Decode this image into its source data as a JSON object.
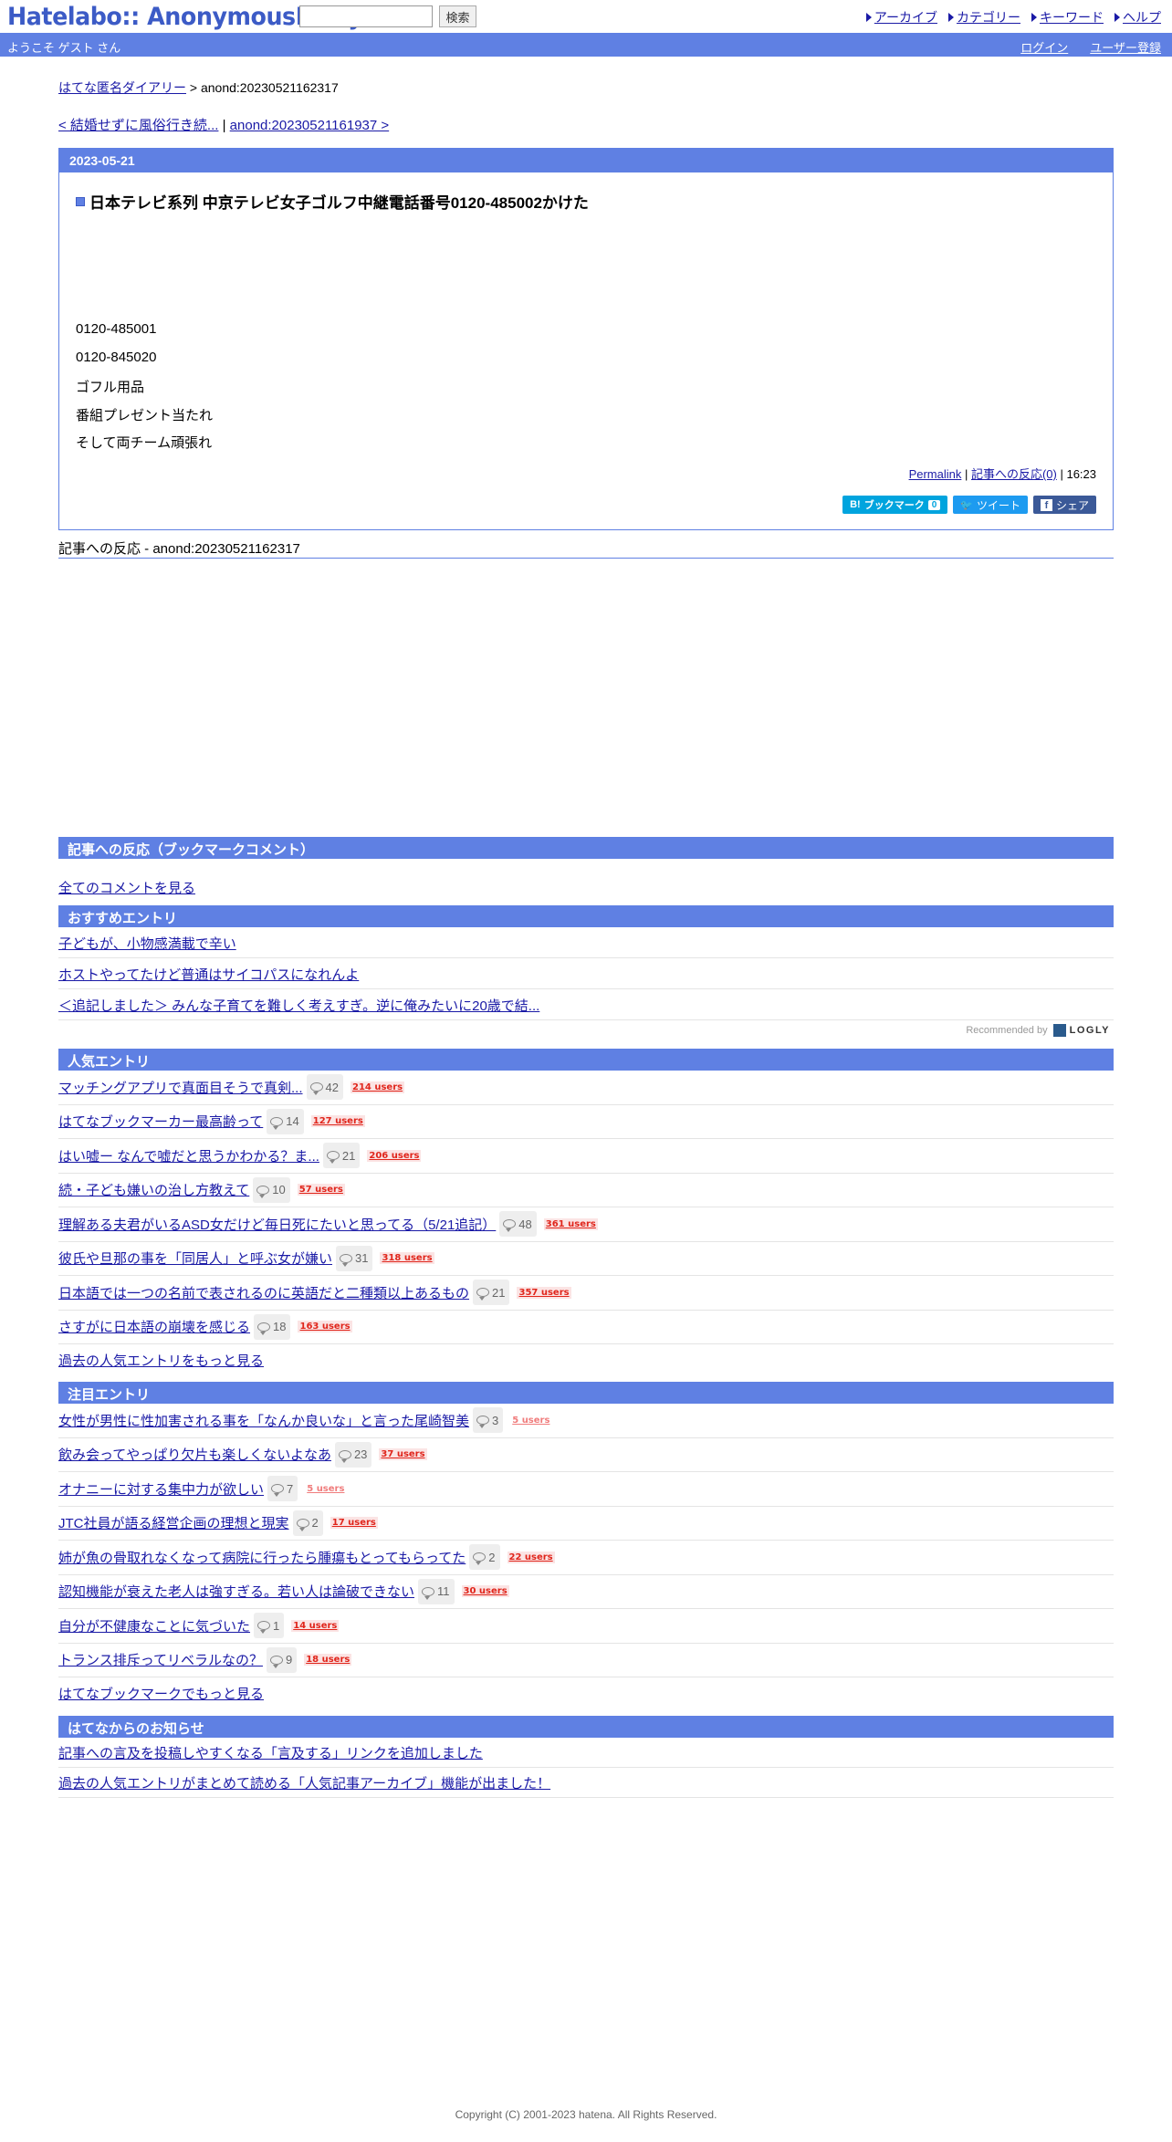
{
  "header": {
    "logo": "Hatelabo:: AnonymousDiary",
    "search_button": "検索",
    "nav": [
      "アーカイブ",
      "カテゴリー",
      "キーワード",
      "ヘルプ"
    ]
  },
  "userbar": {
    "welcome": "ようこそ ゲスト さん",
    "login": "ログイン",
    "register": "ユーザー登録"
  },
  "breadcrumb": {
    "home": "はてな匿名ダイアリー",
    "separator": " > ",
    "current": "anond:20230521162317"
  },
  "prevnext": {
    "prev": "< 結婚せずに風俗行き続...",
    "divider": " | ",
    "next": "anond:20230521161937 >"
  },
  "entry": {
    "date": "2023-05-21",
    "title": "日本テレビ系列 中京テレビ女子ゴルフ中継電話番号0120-485002かけた",
    "lines": [
      "0120-485001",
      "0120-845020",
      "ゴフル用品",
      "番組プレゼント当たれ",
      "そして両チーム頑張れ"
    ],
    "permalink": "Permalink",
    "sep": " | ",
    "reactions": "記事への反応(0)",
    "time": " | 16:23",
    "hatebu_label": "ブックマーク",
    "hatebu_count": "0",
    "tweet_label": "ツイート",
    "share_label": "シェア"
  },
  "refs_title": "記事への反応 - anond:20230521162317",
  "bookmark_comments": {
    "header": "記事への反応（ブックマークコメント）",
    "all_link": "全てのコメントを見る"
  },
  "recommended": {
    "header": "おすすめエントリ",
    "items": [
      "子どもが、小物感満載で辛い",
      "ホストやってたけど普通はサイコパスになれんよ",
      "＜追記しました＞ みんな子育てを難しく考えすぎ。逆に俺みたいに20歳で結..."
    ],
    "recommended_by": "Recommended by",
    "logly": "LOGLY"
  },
  "popular": {
    "header": "人気エントリ",
    "items": [
      {
        "title": "マッチングアプリで真面目そうで真剣...",
        "comments": "42",
        "users": "214 users"
      },
      {
        "title": "はてなブックマーカー最高齢って",
        "comments": "14",
        "users": "127 users"
      },
      {
        "title": "はい嘘ー なんで嘘だと思うかわかる？ま...",
        "comments": "21",
        "users": "206 users"
      },
      {
        "title": "続・子ども嫌いの治し方教えて",
        "comments": "10",
        "users": "57 users"
      },
      {
        "title": "理解ある夫君がいるASD女だけど毎日死にたいと思ってる（5/21追記）",
        "comments": "48",
        "users": "361 users"
      },
      {
        "title": "彼氏や旦那の事を「同居人」と呼ぶ女が嫌い",
        "comments": "31",
        "users": "318 users"
      },
      {
        "title": "日本語では一つの名前で表されるのに英語だと二種類以上あるもの",
        "comments": "21",
        "users": "357 users"
      },
      {
        "title": "さすがに日本語の崩壊を感じる",
        "comments": "18",
        "users": "163 users"
      }
    ],
    "more": "過去の人気エントリをもっと見る"
  },
  "hot": {
    "header": "注目エントリ",
    "items": [
      {
        "title": "女性が男性に性加害される事を「なんか良いな」と言った尾崎智美",
        "comments": "3",
        "users": "5 users"
      },
      {
        "title": "飲み会ってやっぱり欠片も楽しくないよなあ",
        "comments": "23",
        "users": "37 users"
      },
      {
        "title": "オナニーに対する集中力が欲しい",
        "comments": "7",
        "users": "5 users"
      },
      {
        "title": "JTC社員が語る経営企画の理想と現実",
        "comments": "2",
        "users": "17 users"
      },
      {
        "title": "姉が魚の骨取れなくなって病院に行ったら腫瘍もとってもらってた",
        "comments": "2",
        "users": "22 users"
      },
      {
        "title": "認知機能が衰えた老人は強すぎる。若い人は論破できない",
        "comments": "11",
        "users": "30 users"
      },
      {
        "title": "自分が不健康なことに気づいた",
        "comments": "1",
        "users": "14 users"
      },
      {
        "title": "トランス排斥ってリベラルなの？",
        "comments": "9",
        "users": "18 users"
      }
    ],
    "more": "はてなブックマークでもっと見る"
  },
  "notices": {
    "header": "はてなからのお知らせ",
    "items": [
      "記事への言及を投稿しやすくなる「言及する」リンクを追加しました",
      "過去の人気エントリがまとめて読める「人気記事アーカイブ」機能が出ました！"
    ]
  },
  "footer": {
    "copyright": "Copyright (C) 2001-2023 hatena. All Rights Reserved."
  },
  "colors": {
    "accent": "#5f80e3",
    "link": "#1a1aa6",
    "users": "#e0251b"
  }
}
